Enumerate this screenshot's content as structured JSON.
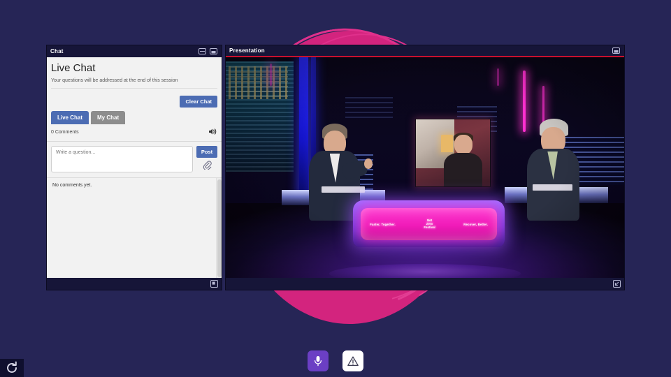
{
  "background": {
    "color": "#262556",
    "accent_circle": "#d3247e",
    "accent_arc": "#e0308c"
  },
  "chat_panel": {
    "header_title": "Chat",
    "header_icons": [
      {
        "name": "minimize-panel-icon",
        "glyph": "⊟"
      },
      {
        "name": "panel-layout-icon",
        "glyph": "⊟"
      }
    ],
    "title": "Live Chat",
    "subtitle": "Your questions will be addressed at the end of this session",
    "clear_chat_label": "Clear Chat",
    "tabs": [
      {
        "label": "Live Chat",
        "active": true
      },
      {
        "label": "My Chat",
        "active": false
      }
    ],
    "comment_count_label": "0 Comments",
    "sound_icon": "speaker-icon",
    "input_placeholder": "Write a question...",
    "input_value": "",
    "post_label": "Post",
    "attach_icon": "paperclip-icon",
    "empty_state": "No comments yet.",
    "expand_icon": "expand-icon",
    "colors": {
      "button_blue": "#4c6cb3",
      "tab_inactive": "#8d8d8d"
    }
  },
  "presentation_panel": {
    "header_title": "Presentation",
    "header_icon": "panel-layout-icon",
    "accent_border": "#c8102e",
    "expand_icon": "expand-icon",
    "video": {
      "description": "Television studio panel discussion",
      "desk_left_text": "Faster, Together.",
      "desk_center_line1": "Net",
      "desk_center_line2": "Zero",
      "desk_center_line3": "Festival",
      "desk_right_text": "Recover, Better.",
      "participants": [
        "host-left",
        "remote-guest-screen",
        "host-right"
      ]
    }
  },
  "controls": [
    {
      "name": "microphone-button",
      "icon": "microphone-icon",
      "color": "#6b3fc4",
      "state": "on"
    },
    {
      "name": "alert-button",
      "icon": "warning-triangle-icon",
      "color": "#ffffff",
      "state": "default"
    }
  ],
  "corner": {
    "reload_icon": "reload-icon"
  }
}
